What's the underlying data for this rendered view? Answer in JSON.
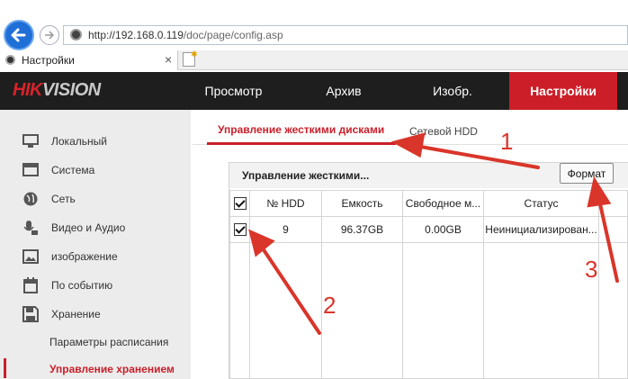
{
  "browser": {
    "url_host": "http://192.168.0.119",
    "url_path": "/doc/page/config.asp",
    "tab_title": "Настройки",
    "tab_close": "×"
  },
  "header": {
    "logo_part1": "HIK",
    "logo_part2": "VISION",
    "nav": [
      "Просмотр",
      "Архив",
      "Изобр.",
      "Настройки"
    ],
    "active_nav": "Настройки",
    "active_color": "#cc1e28"
  },
  "sidebar": {
    "items": [
      {
        "label": "Локальный",
        "icon": "monitor-icon"
      },
      {
        "label": "Система",
        "icon": "window-icon"
      },
      {
        "label": "Сеть",
        "icon": "globe-icon"
      },
      {
        "label": "Видео и Аудио",
        "icon": "microphone-icon"
      },
      {
        "label": "изображение",
        "icon": "image-icon"
      },
      {
        "label": "По событию",
        "icon": "calendar-icon"
      },
      {
        "label": "Хранение",
        "icon": "floppy-disk-icon"
      }
    ],
    "subitems": [
      {
        "label": "Параметры расписания"
      },
      {
        "label": "Управление хранением",
        "active": true
      }
    ]
  },
  "main": {
    "tabs": [
      "Управление жесткими дисками",
      "Сетевой HDD"
    ],
    "panel_title": "Управление жесткими...",
    "format_button": "Формат",
    "table": {
      "headers": [
        "№ HDD",
        "Емкость",
        "Свободное м...",
        "Статус"
      ],
      "rows": [
        {
          "checked": true,
          "hdd": "9",
          "capacity": "96.37GB",
          "free": "0.00GB",
          "status": "Неинициализирован..."
        }
      ]
    }
  },
  "annotations": [
    "1",
    "2",
    "3"
  ],
  "colors": {
    "accent": "#c8202a",
    "annotation": "#d9352a",
    "header_bg": "#1e1e1e"
  }
}
